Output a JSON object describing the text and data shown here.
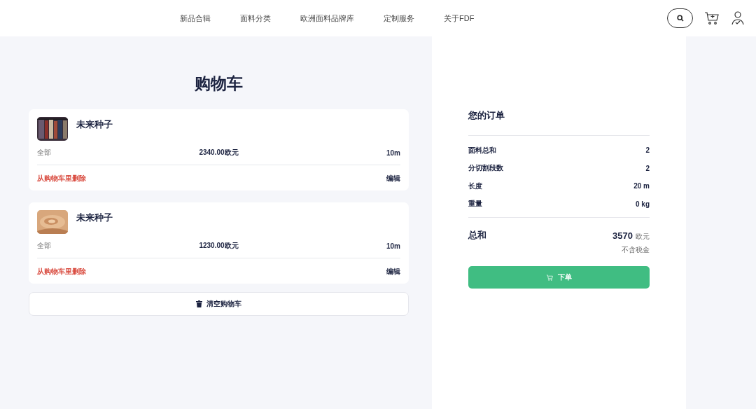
{
  "nav": {
    "items": [
      "新品合辑",
      "面料分类",
      "欧洲面料品牌库",
      "定制服务",
      "关于FDF"
    ]
  },
  "cart": {
    "title": "购物车",
    "items": [
      {
        "name": "未来种子",
        "quantity_label": "全部",
        "price": "2340.00欧元",
        "length": "10m",
        "remove": "从购物车里删除",
        "edit": "编辑"
      },
      {
        "name": "未来种子",
        "quantity_label": "全部",
        "price": "1230.00欧元",
        "length": "10m",
        "remove": "从购物车里删除",
        "edit": "编辑"
      }
    ],
    "clear_button": "清空购物车"
  },
  "order": {
    "title": "您的订单",
    "rows": [
      {
        "label": "面料总和",
        "value": "2"
      },
      {
        "label": "分切割段数",
        "value": "2"
      },
      {
        "label": "长度",
        "value": "20 m"
      },
      {
        "label": "重量",
        "value": "0 kg"
      }
    ],
    "total_label": "总和",
    "total_amount": "3570",
    "currency": "欧元",
    "tax_note": "不含税金",
    "submit_button": "下单"
  }
}
